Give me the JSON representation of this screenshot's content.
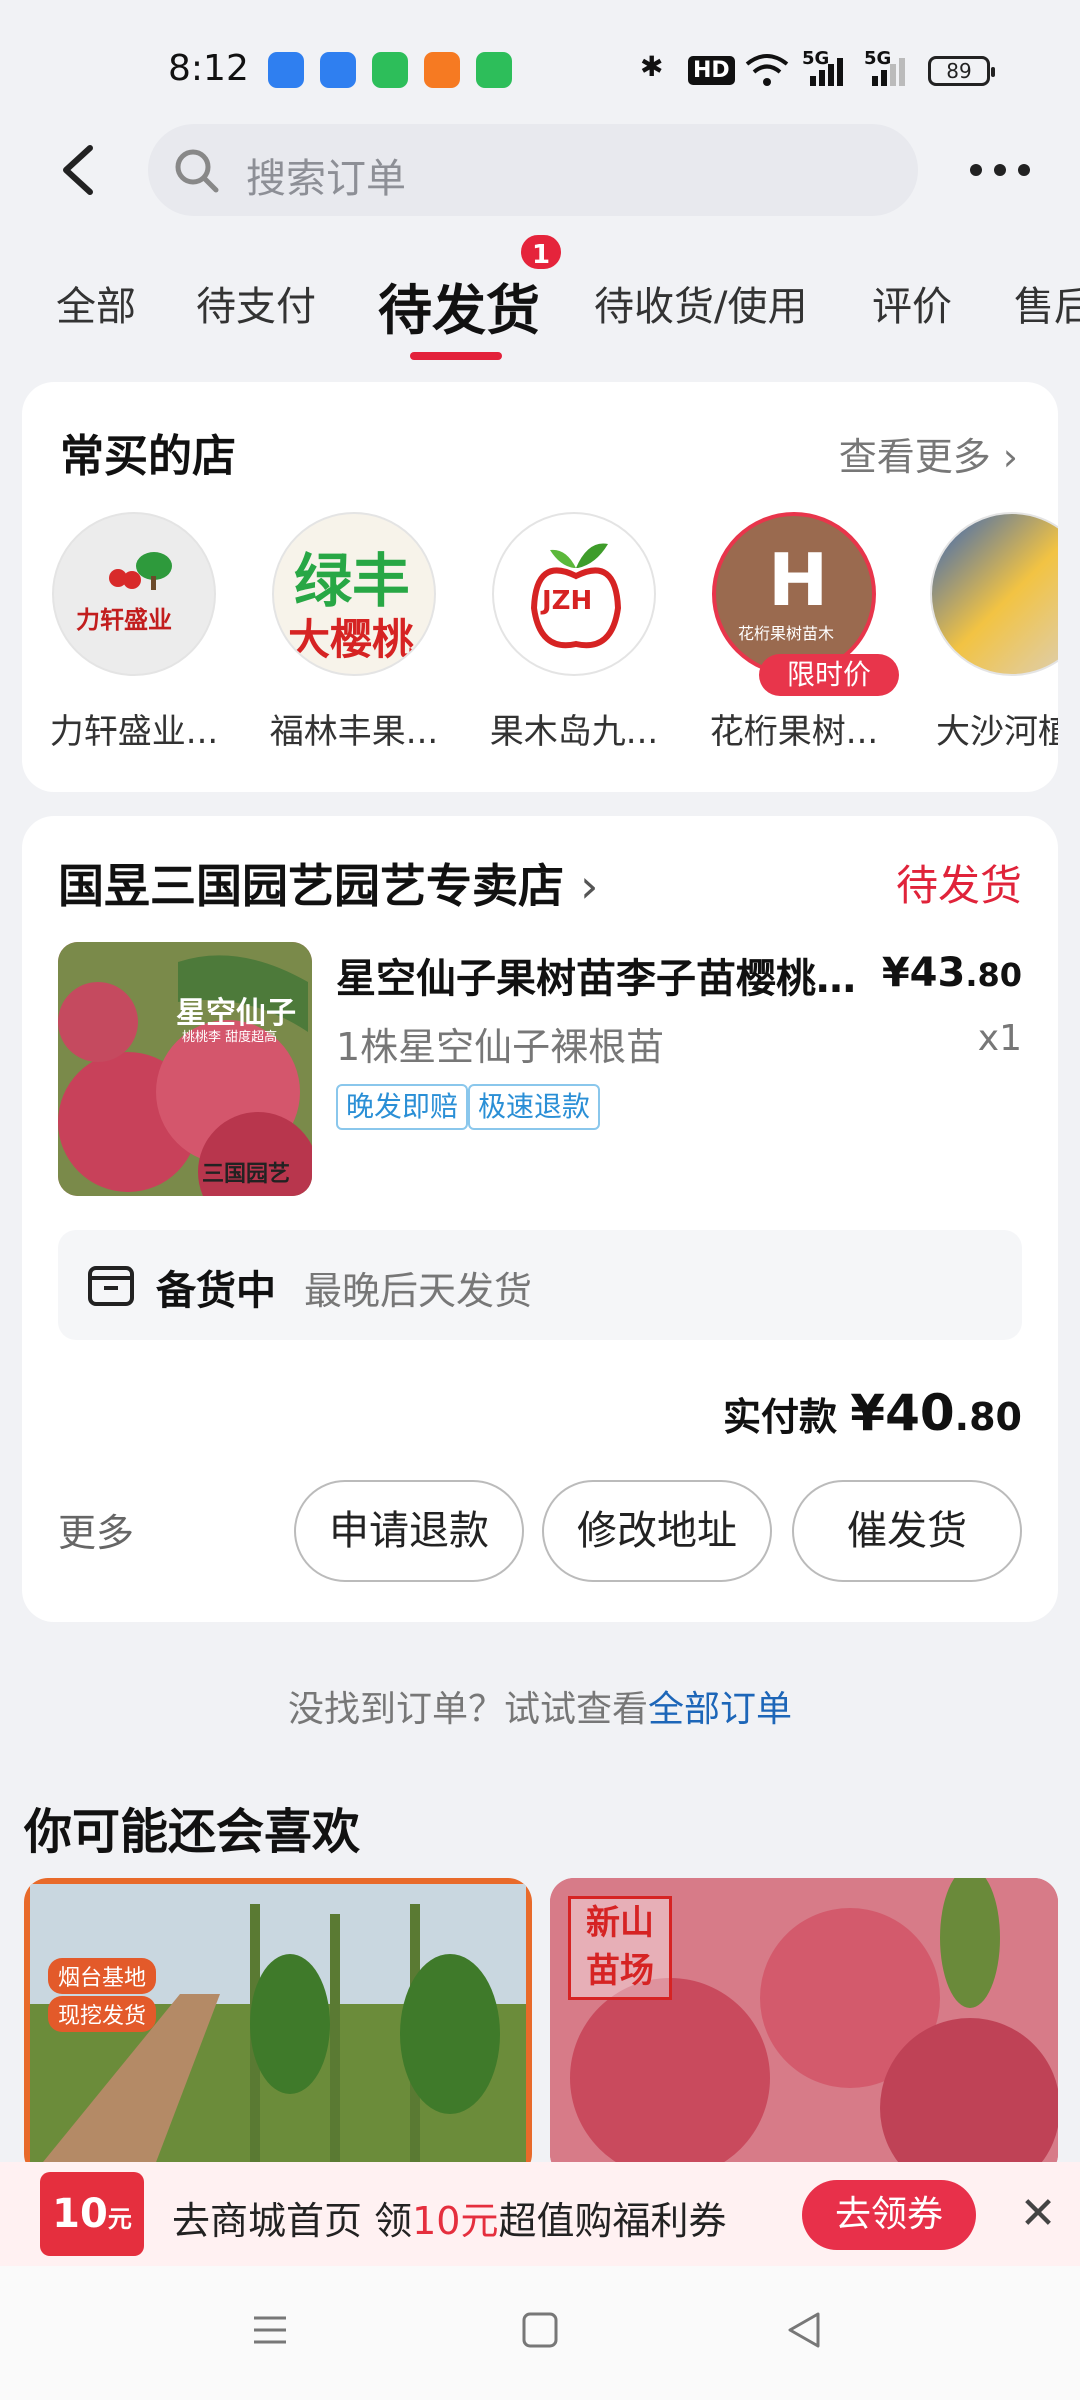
{
  "status_bar": {
    "time": "8:12",
    "network": "5G",
    "network2": "5G",
    "hd": "HD",
    "battery": "89"
  },
  "search": {
    "placeholder": "搜索订单"
  },
  "tabs": [
    {
      "label": "全部"
    },
    {
      "label": "待支付"
    },
    {
      "label": "待发货",
      "active": true,
      "badge": "1"
    },
    {
      "label": "待收货/使用"
    },
    {
      "label": "评价"
    },
    {
      "label": "售后"
    }
  ],
  "frequent_shops": {
    "title": "常买的店",
    "more": "查看更多",
    "shops": [
      {
        "name": "力轩盛业...",
        "logo_text": "力轩盛业"
      },
      {
        "name": "福林丰果...",
        "logo_text_top": "绿丰",
        "logo_text_bottom": "大樱桃"
      },
      {
        "name": "果木岛九...",
        "logo_text": "JZH"
      },
      {
        "name": "花桁果树...",
        "logo_text": "H",
        "logo_sub": "花桁果树苗木",
        "tag": "限时价"
      },
      {
        "name": "大沙河植..."
      }
    ]
  },
  "order": {
    "store": "国昱三国园艺园艺专卖店",
    "status": "待发货",
    "product_title": "星空仙子果树苗李子苗樱桃...",
    "product_image_text": "星空仙子",
    "product_image_sub": "桃桃李 甜度超高",
    "product_image_brand": "三国园艺",
    "price_int": "¥43",
    "price_dec": ".80",
    "spec": "1株星空仙子裸根苗",
    "qty": "x1",
    "tags": [
      "晚发即赔",
      "极速退款"
    ],
    "ship_label": "备货中",
    "ship_note": "最晚后天发货",
    "paid_label": "实付款",
    "paid_int": "¥40",
    "paid_dec": ".80",
    "more": "更多",
    "buttons": [
      "申请退款",
      "修改地址",
      "催发货"
    ]
  },
  "not_found": {
    "text": "没找到订单？试试查看",
    "link": "全部订单"
  },
  "recommend": {
    "title": "你可能还会喜欢",
    "items": [
      {
        "badges": [
          "烟台基地",
          "现挖发货"
        ]
      },
      {
        "stamp": "新山苗场"
      }
    ]
  },
  "coupon_bar": {
    "badge_num": "10",
    "badge_unit": "元",
    "text_pre": "去商城首页 领",
    "text_red": "10元",
    "text_post": "超值购福利券",
    "button": "去领券",
    "close": "✕"
  },
  "colors": {
    "accent": "#e3213a",
    "link": "#1d66b8",
    "tag_blue": "#2a8fd6"
  }
}
